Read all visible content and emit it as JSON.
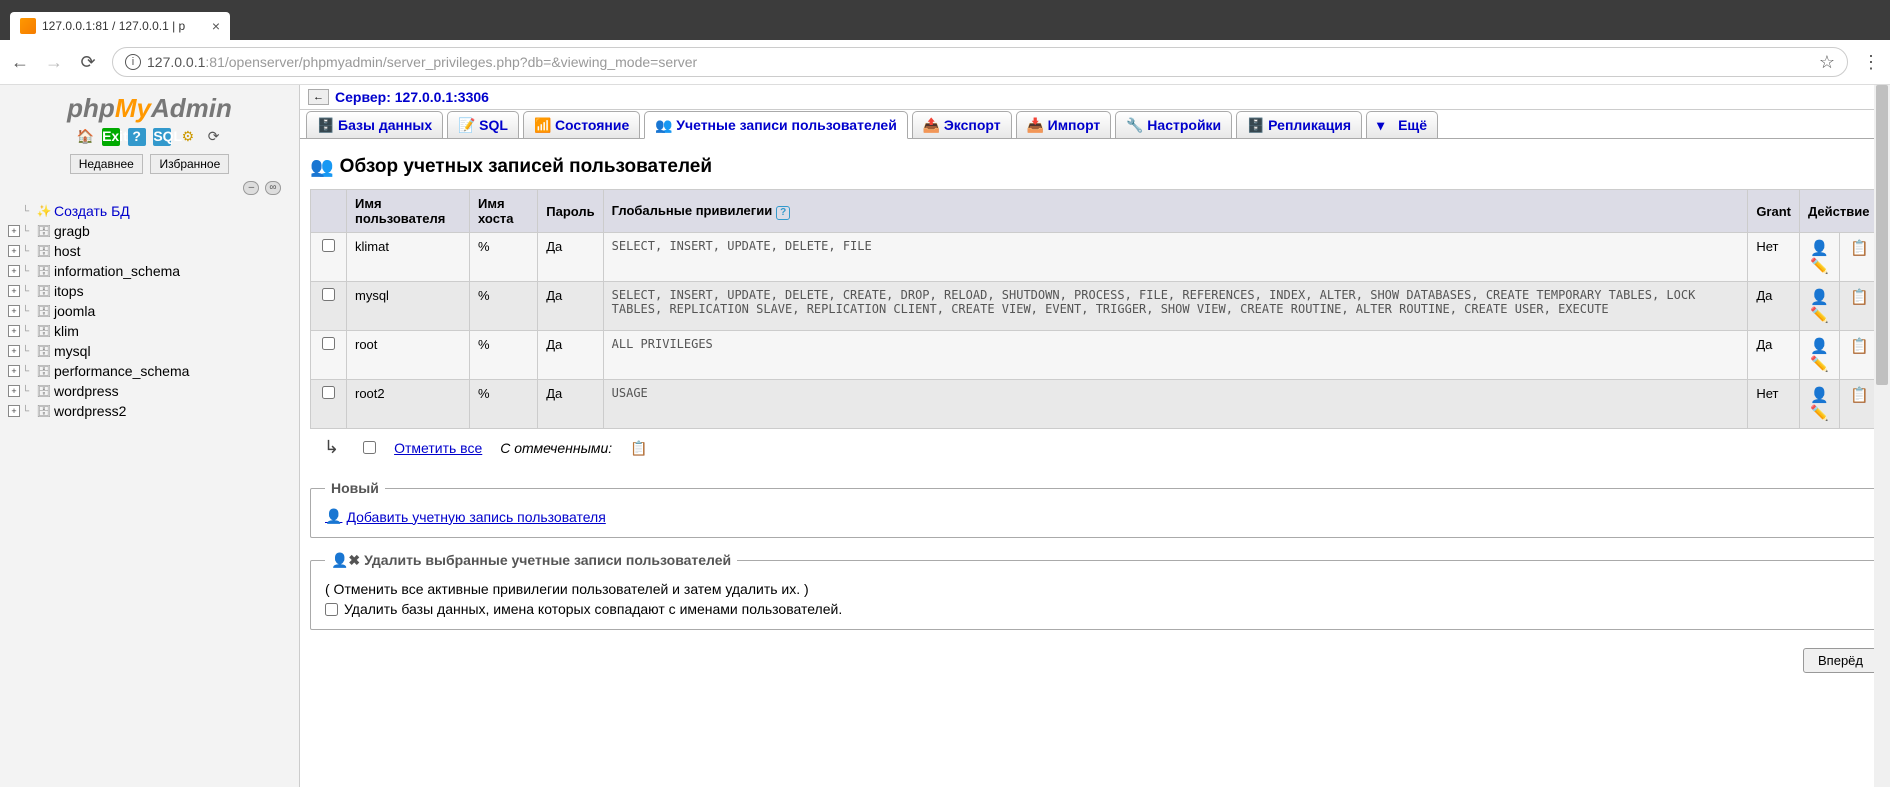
{
  "browser": {
    "tab_title": "127.0.0.1:81 / 127.0.0.1 | p",
    "url": "127.0.0.1:81/openserver/phpmyadmin/server_privileges.php?db=&viewing_mode=server",
    "url_host": "127.0.0.1",
    "url_port_path": ":81/openserver/phpmyadmin/server_privileges.php?db=&viewing_mode=server"
  },
  "sidebar": {
    "recent_label": "Недавнее",
    "favorite_label": "Избранное",
    "new_db_label": "Создать БД",
    "databases": [
      "gragb",
      "host",
      "information_schema",
      "itops",
      "joomla",
      "klim",
      "mysql",
      "performance_schema",
      "wordpress",
      "wordpress2"
    ]
  },
  "server": {
    "label": "Сервер: 127.0.0.1:3306"
  },
  "tabs": [
    {
      "label": "Базы данных",
      "icon": "🗄️"
    },
    {
      "label": "SQL",
      "icon": "📝"
    },
    {
      "label": "Состояние",
      "icon": "📶"
    },
    {
      "label": "Учетные записи пользователей",
      "icon": "👥",
      "active": true
    },
    {
      "label": "Экспорт",
      "icon": "📤"
    },
    {
      "label": "Импорт",
      "icon": "📥"
    },
    {
      "label": "Настройки",
      "icon": "🔧"
    },
    {
      "label": "Репликация",
      "icon": "🗄️"
    },
    {
      "label": "Ещё",
      "icon": "▾"
    }
  ],
  "page": {
    "title": "Обзор учетных записей пользователей"
  },
  "table": {
    "headers": {
      "user": "Имя пользователя",
      "host": "Имя хоста",
      "password": "Пароль",
      "priv": "Глобальные привилегии",
      "grant": "Grant",
      "action": "Действие"
    },
    "rows": [
      {
        "user": "klimat",
        "host": "%",
        "password": "Да",
        "priv": "SELECT, INSERT, UPDATE, DELETE, FILE",
        "grant": "Нет"
      },
      {
        "user": "mysql",
        "host": "%",
        "password": "Да",
        "priv": "SELECT, INSERT, UPDATE, DELETE, CREATE, DROP, RELOAD, SHUTDOWN, PROCESS, FILE, REFERENCES, INDEX, ALTER, SHOW DATABASES, CREATE TEMPORARY TABLES, LOCK TABLES, REPLICATION SLAVE, REPLICATION CLIENT, CREATE VIEW, EVENT, TRIGGER, SHOW VIEW, CREATE ROUTINE, ALTER ROUTINE, CREATE USER, EXECUTE",
        "grant": "Да"
      },
      {
        "user": "root",
        "host": "%",
        "password": "Да",
        "priv": "ALL PRIVILEGES",
        "grant": "Да"
      },
      {
        "user": "root2",
        "host": "%",
        "password": "Да",
        "priv": "USAGE",
        "grant": "Нет"
      }
    ]
  },
  "checkall": {
    "label": "Отметить все",
    "with_selected": "С отмеченными:"
  },
  "fieldset_new": {
    "legend": "Новый",
    "add_link": "Добавить учетную запись пользователя"
  },
  "fieldset_delete": {
    "legend": "Удалить выбранные учетные записи пользователей",
    "note": "( Отменить все активные привилегии пользователей и затем удалить их. )",
    "checkbox_label": "Удалить базы данных, имена которых совпадают с именами пользователей."
  },
  "submit": {
    "label": "Вперёд"
  }
}
